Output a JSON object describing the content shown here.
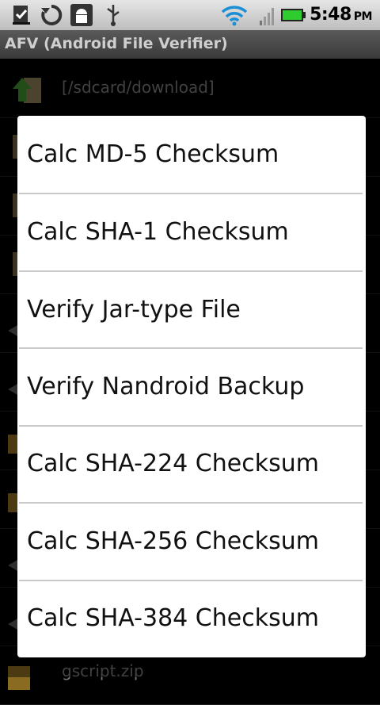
{
  "status_bar": {
    "icons": [
      "download-done-icon",
      "sync-icon",
      "android-debug-icon",
      "usb-icon"
    ],
    "right_icons": [
      "wifi-icon",
      "signal-icon",
      "battery-icon"
    ],
    "time": "5:48",
    "ampm": "PM",
    "colors": {
      "wifi": "#1a8fd6",
      "battery": "#2ecc2e"
    }
  },
  "app": {
    "title": "AFV (Android File Verifier)"
  },
  "file_list": {
    "path": "[/sdcard/download]",
    "partial_last_item": "gscript.zip"
  },
  "menu": {
    "items": [
      {
        "label": "Calc MD-5 Checksum"
      },
      {
        "label": "Calc SHA-1 Checksum"
      },
      {
        "label": "Verify Jar-type File"
      },
      {
        "label": "Verify Nandroid Backup"
      },
      {
        "label": "Calc SHA-224 Checksum"
      },
      {
        "label": "Calc SHA-256 Checksum"
      },
      {
        "label": "Calc SHA-384 Checksum"
      }
    ]
  }
}
